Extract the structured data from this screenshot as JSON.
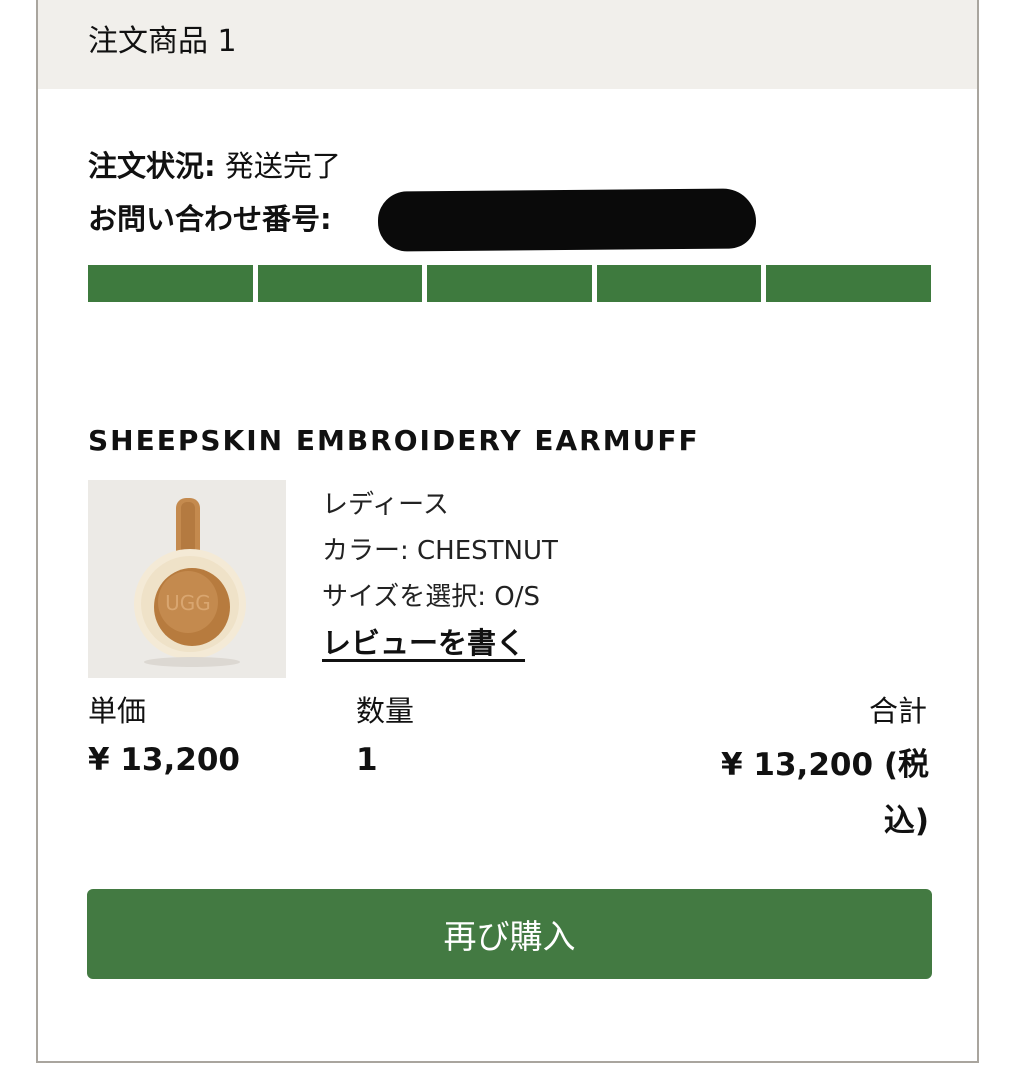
{
  "header": {
    "title": "注文商品 1"
  },
  "order": {
    "status_label": "注文状況:",
    "status_value": "発送完了",
    "inquiry_label": "お問い合わせ番号:",
    "progress_segments_complete": 5,
    "progress_segments_total": 5
  },
  "product": {
    "name": "SHEEPSKIN EMBROIDERY EARMUFF",
    "gender": "レディース",
    "color": "カラー: CHESTNUT",
    "size": "サイズを選択: O/S",
    "review_link": "レビューを書く",
    "image_logo_text": "UGG"
  },
  "pricing": {
    "unit_label": "単価",
    "qty_label": "数量",
    "total_label": "合計",
    "unit_value": "¥ 13,200",
    "qty_value": "1",
    "total_value": "¥ 13,200 (税込)"
  },
  "actions": {
    "rebuy_label": "再び購入"
  },
  "colors": {
    "accent_green": "#437a42",
    "progress_green": "#3e7a3e",
    "header_bg": "#f1efeb",
    "border": "#a9a59e"
  }
}
